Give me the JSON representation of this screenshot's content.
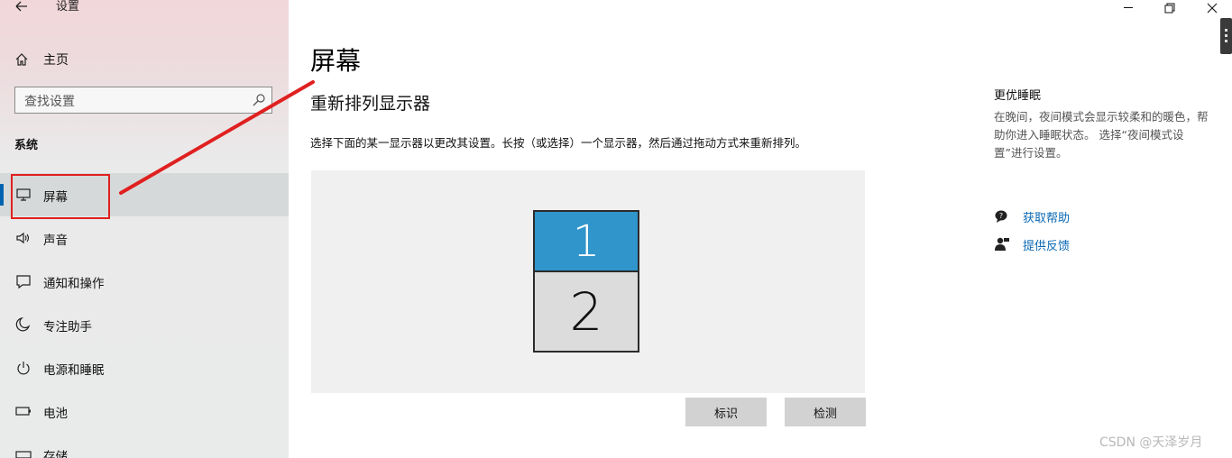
{
  "window": {
    "title": "设置"
  },
  "sidebar": {
    "home_label": "主页",
    "search_placeholder": "查找设置",
    "section_title": "系统",
    "items": [
      {
        "label": "屏幕",
        "icon": "monitor-icon",
        "selected": true
      },
      {
        "label": "声音",
        "icon": "speaker-icon",
        "selected": false
      },
      {
        "label": "通知和操作",
        "icon": "notification-icon",
        "selected": false
      },
      {
        "label": "专注助手",
        "icon": "moon-icon",
        "selected": false
      },
      {
        "label": "电源和睡眠",
        "icon": "power-icon",
        "selected": false
      },
      {
        "label": "电池",
        "icon": "battery-icon",
        "selected": false
      },
      {
        "label": "存储",
        "icon": "storage-icon",
        "selected": false
      }
    ]
  },
  "main": {
    "page_title": "屏幕",
    "subtitle": "重新排列显示器",
    "description": "选择下面的某一显示器以更改其设置。长按（或选择）一个显示器，然后通过拖动方式来重新排列。",
    "monitors": [
      {
        "number": "1",
        "selected": true
      },
      {
        "number": "2",
        "selected": false
      }
    ],
    "identify_button": "标识",
    "detect_button": "检测"
  },
  "right_panel": {
    "title": "更优睡眠",
    "description": "在晚间，夜间模式会显示较柔和的暖色，帮助你进入睡眠状态。 选择“夜间模式设置”进行设置。",
    "help_link": "获取帮助",
    "feedback_link": "提供反馈"
  },
  "watermark": "CSDN @天泽岁月",
  "colors": {
    "accent": "#0063b1",
    "monitor_selected": "#2f95cb",
    "link": "#0b69b4",
    "annotation": "#e02020"
  }
}
